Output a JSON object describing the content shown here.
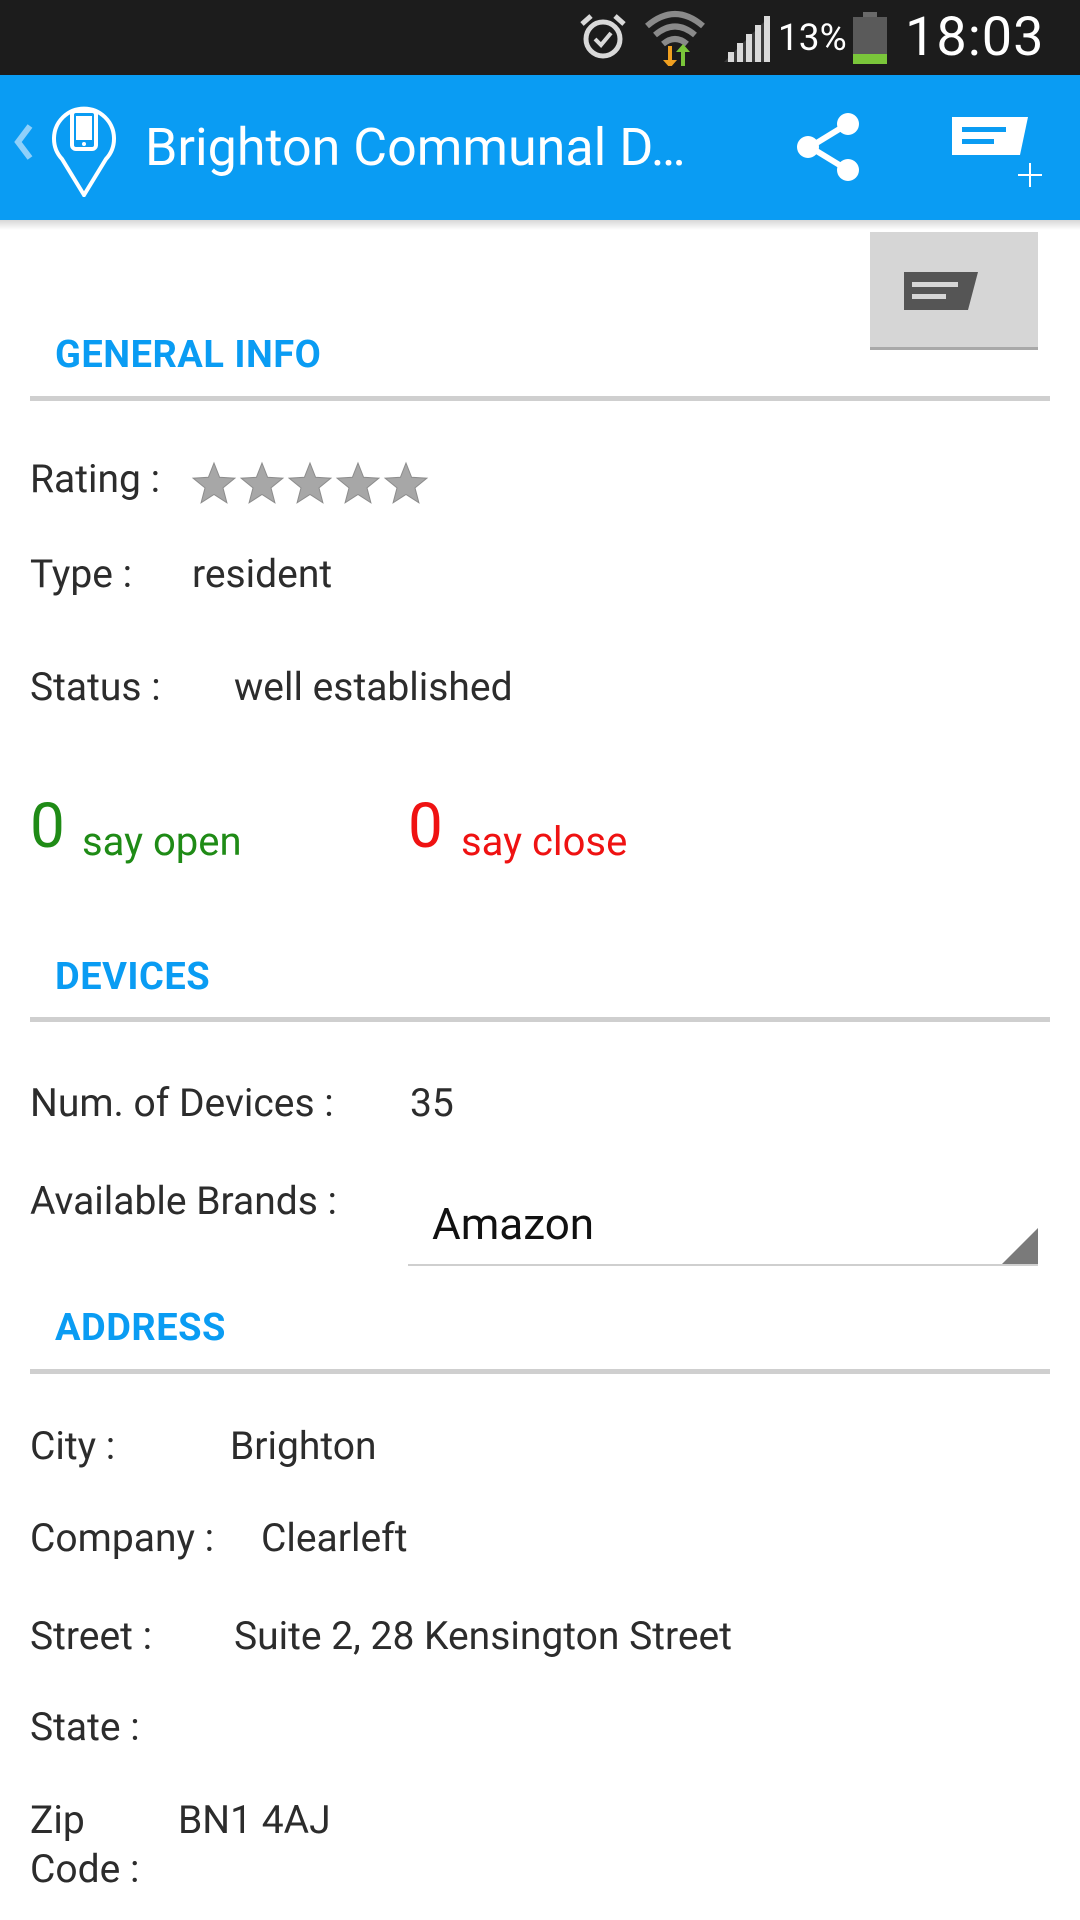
{
  "status_bar": {
    "battery_percent": "13%",
    "time": "18:03",
    "icons": [
      "alarm-icon",
      "wifi-icon",
      "signal-icon",
      "battery-icon"
    ]
  },
  "action_bar": {
    "title": "Brighton Communal D…",
    "icons": [
      "up-chevron-icon",
      "phone-location-icon",
      "share-icon",
      "add-comment-icon"
    ],
    "color": "#0a9cf3"
  },
  "comment_button": {
    "icon": "comment-icon"
  },
  "general_info": {
    "title": "GENERAL INFO",
    "rating_label": "Rating :",
    "rating_value": 0,
    "rating_max": 5,
    "type_label": "Type :",
    "type_value": "resident",
    "status_label": "Status :",
    "status_value": "well established",
    "open_count": "0",
    "open_label": "say open",
    "close_count": "0",
    "close_label": "say close",
    "open_color": "#1f8b16",
    "close_color": "#ef1212"
  },
  "devices": {
    "title": "DEVICES",
    "num_label": "Num. of Devices :",
    "num_value": "35",
    "brands_label": "Available Brands :",
    "brands_selected": "Amazon"
  },
  "address": {
    "title": "ADDRESS",
    "city_label": "City :",
    "city_value": "Brighton",
    "company_label": "Company :",
    "company_value": "Clearleft",
    "street_label": "Street :",
    "street_value": "Suite 2, 28 Kensington Street",
    "state_label": "State :",
    "state_value": "",
    "zip_label_line1": "Zip",
    "zip_label_line2": "Code :",
    "zip_value": "BN1 4AJ"
  }
}
